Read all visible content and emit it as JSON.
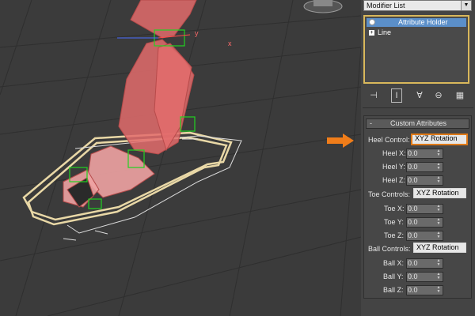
{
  "modifier_list": {
    "label": "Modifier List"
  },
  "stack": {
    "items": [
      {
        "label": "Attribute Holder",
        "selected": true,
        "icon": "lightbulb-icon"
      },
      {
        "label": "Line",
        "selected": false,
        "icon": "plus-icon"
      }
    ]
  },
  "toolbar": {
    "icons": [
      "pin-stack-icon",
      "show-end-result-icon",
      "make-unique-icon",
      "remove-modifier-icon",
      "configure-modifier-sets-icon"
    ]
  },
  "rollout": {
    "title": "Custom Attributes",
    "collapse": "-",
    "groups": [
      {
        "label": "Heel Control:",
        "value": "XYZ Rotation",
        "highlight": true,
        "spinners": [
          {
            "label": "Heel X:",
            "value": "0.0"
          },
          {
            "label": "Heel Y:",
            "value": "0.0"
          },
          {
            "label": "Heel Z:",
            "value": "0.0"
          }
        ]
      },
      {
        "label": "Toe Controls:",
        "value": "XYZ Rotation",
        "highlight": false,
        "spinners": [
          {
            "label": "Toe X:",
            "value": "0.0"
          },
          {
            "label": "Toe Y:",
            "value": "0.0"
          },
          {
            "label": "Toe Z:",
            "value": "0.0"
          }
        ]
      },
      {
        "label": "Ball Controls:",
        "value": "XYZ Rotation",
        "highlight": false,
        "spinners": [
          {
            "label": "Ball X:",
            "value": "0.0"
          },
          {
            "label": "Ball Y:",
            "value": "0.0"
          },
          {
            "label": "Ball Z:",
            "value": "0.0"
          }
        ]
      }
    ]
  },
  "viewport": {
    "axis_labels": {
      "y": "y",
      "x": "x"
    }
  },
  "colors": {
    "accent_orange": "#f07d1a",
    "selection_blue": "#5b8fc9",
    "stack_border": "#d9b85b"
  }
}
